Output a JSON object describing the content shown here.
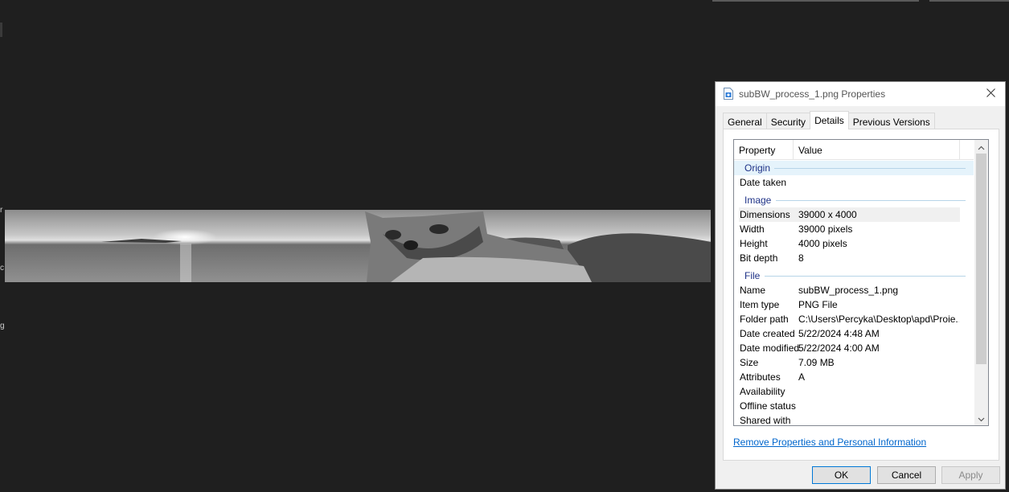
{
  "dialog": {
    "title": "subBW_process_1.png Properties",
    "tabs": [
      "General",
      "Security",
      "Details",
      "Previous Versions"
    ],
    "active_tab": "Details",
    "columns": [
      "Property",
      "Value"
    ],
    "groups": [
      {
        "label": "Origin",
        "rows": [
          {
            "k": "Date taken",
            "v": ""
          }
        ]
      },
      {
        "label": "Image",
        "rows": [
          {
            "k": "Dimensions",
            "v": "39000 x 4000"
          },
          {
            "k": "Width",
            "v": "39000 pixels"
          },
          {
            "k": "Height",
            "v": "4000 pixels"
          },
          {
            "k": "Bit depth",
            "v": "8"
          }
        ]
      },
      {
        "label": "File",
        "rows": [
          {
            "k": "Name",
            "v": "subBW_process_1.png"
          },
          {
            "k": "Item type",
            "v": "PNG File"
          },
          {
            "k": "Folder path",
            "v": "C:\\Users\\Percyka\\Desktop\\apd\\Proie..."
          },
          {
            "k": "Date created",
            "v": "5/22/2024 4:48 AM"
          },
          {
            "k": "Date modified",
            "v": "5/22/2024 4:00 AM"
          },
          {
            "k": "Size",
            "v": "7.09 MB"
          },
          {
            "k": "Attributes",
            "v": "A"
          },
          {
            "k": "Availability",
            "v": ""
          },
          {
            "k": "Offline status",
            "v": ""
          },
          {
            "k": "Shared with",
            "v": ""
          }
        ]
      }
    ],
    "link": "Remove Properties and Personal Information",
    "buttons": {
      "ok": "OK",
      "cancel": "Cancel",
      "apply": "Apply"
    }
  },
  "edge_glyphs": [
    "r",
    "c",
    "g"
  ]
}
